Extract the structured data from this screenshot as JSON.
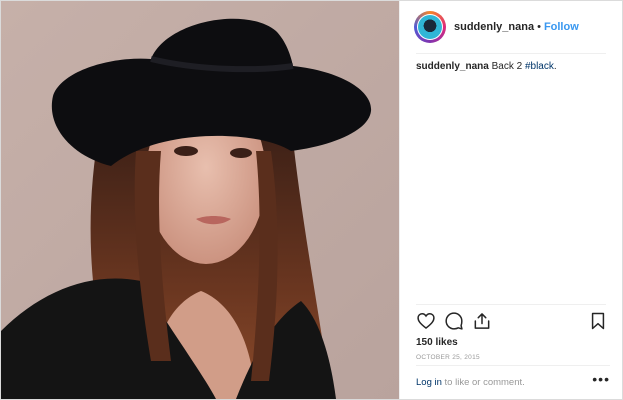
{
  "post": {
    "author": {
      "username": "suddenly_nana",
      "follow_label": "Follow",
      "separator": "•"
    },
    "caption": {
      "username": "suddenly_nana",
      "text": "Back 2 ",
      "hashtag": "#black",
      "suffix": "."
    },
    "likes": "150 likes",
    "date": "OCTOBER 25, 2015",
    "comment_prompt": {
      "login_label": "Log in",
      "rest": " to like or comment."
    },
    "more_label": "•••"
  },
  "icons": [
    "heart-icon",
    "comment-icon",
    "share-icon",
    "bookmark-icon",
    "more-options-icon"
  ],
  "colors": {
    "link_blue": "#3897f0",
    "hashtag": "#003569",
    "muted": "#999999",
    "border": "#efefef"
  }
}
